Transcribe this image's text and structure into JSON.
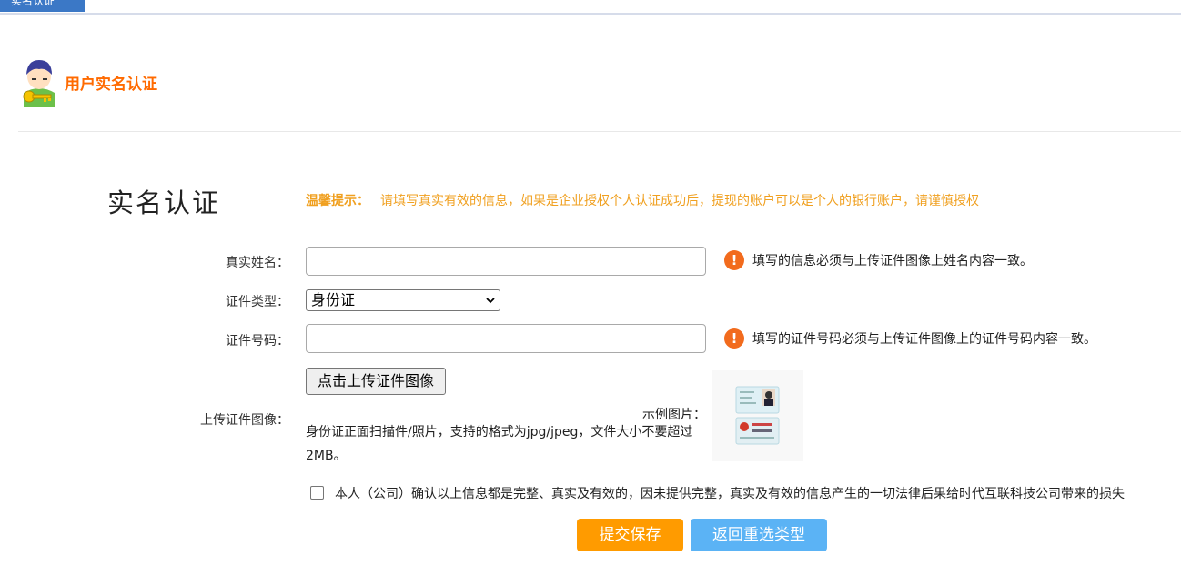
{
  "top_tab": {
    "label": "实名认证"
  },
  "header": {
    "title": "用户实名认证"
  },
  "page": {
    "title": "实名认证",
    "tip_label": "温馨提示：",
    "tip_text": "请填写真实有效的信息，如果是企业授权个人认证成功后，提现的账户可以是个人的银行账户，请谨慎授权"
  },
  "form": {
    "name": {
      "label": "真实姓名：",
      "value": "",
      "hint": "填写的信息必须与上传证件图像上姓名内容一致。"
    },
    "id_type": {
      "label": "证件类型：",
      "selected": "身份证"
    },
    "id_number": {
      "label": "证件号码：",
      "value": "",
      "hint": "填写的证件号码必须与上传证件图像上的证件号码内容一致。"
    },
    "upload": {
      "label": "上传证件图像：",
      "button": "点击上传证件图像",
      "description": "身份证正面扫描件/照片，支持的格式为jpg/jpeg，文件大小不要超过2MB。",
      "sample_label": "示例图片："
    },
    "confirm": {
      "checked": false,
      "text": "本人（公司）确认以上信息都是完整、真实及有效的，因未提供完整，真实及有效的信息产生的一切法律后果给时代互联科技公司带来的损失"
    }
  },
  "buttons": {
    "submit": "提交保存",
    "back": "返回重选类型"
  },
  "icons": {
    "warning": "warning-icon",
    "avatar": "user-key-avatar-icon",
    "dropdown": "chevron-down-icon"
  },
  "colors": {
    "accent_orange": "#ff6a00",
    "tip": "#f0a020",
    "submit": "#ff9b00",
    "back": "#5bb3f5",
    "tab": "#3b78c6"
  }
}
